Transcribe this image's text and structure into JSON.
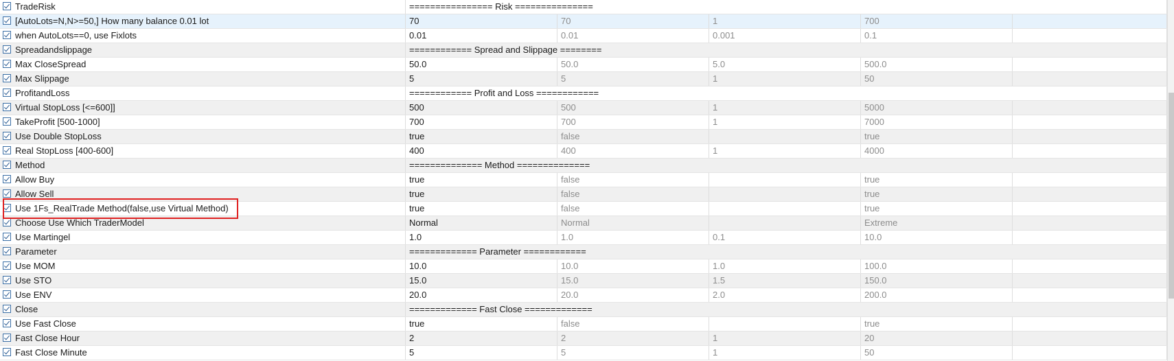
{
  "rows": [
    {
      "name": "TradeRisk",
      "header": "================ Risk ==============="
    },
    {
      "name": "[AutoLots=N,N>=50,] How many balance 0.01 lot",
      "value": "70",
      "start": "70",
      "step": "1",
      "stop": "700"
    },
    {
      "name": "when AutoLots==0,  use Fixlots",
      "value": "0.01",
      "start": "0.01",
      "step": "0.001",
      "stop": "0.1"
    },
    {
      "name": "Spreadandslippage",
      "header": "============ Spread and Slippage ========"
    },
    {
      "name": "Max CloseSpread",
      "value": "50.0",
      "start": "50.0",
      "step": "5.0",
      "stop": "500.0"
    },
    {
      "name": "Max Slippage",
      "value": "5",
      "start": "5",
      "step": "1",
      "stop": "50"
    },
    {
      "name": "ProfitandLoss",
      "header": "============ Profit and Loss ============"
    },
    {
      "name": "Virtual StopLoss [<=600]]",
      "value": "500",
      "start": "500",
      "step": "1",
      "stop": "5000"
    },
    {
      "name": "TakeProfit [500-1000]",
      "value": "700",
      "start": "700",
      "step": "1",
      "stop": "7000"
    },
    {
      "name": "Use Double StopLoss",
      "value": "true",
      "start": "false",
      "step": "",
      "stop": "true"
    },
    {
      "name": "Real StopLoss [400-600]",
      "value": "400",
      "start": "400",
      "step": "1",
      "stop": "4000"
    },
    {
      "name": "Method",
      "header": "============== Method =============="
    },
    {
      "name": "Allow Buy",
      "value": "true",
      "start": "false",
      "step": "",
      "stop": "true"
    },
    {
      "name": "Allow Sell",
      "value": "true",
      "start": "false",
      "step": "",
      "stop": "true"
    },
    {
      "name": "Use 1Fs_RealTrade Method(false,use Virtual Method)",
      "value": "true",
      "start": "false",
      "step": "",
      "stop": "true"
    },
    {
      "name": "Choose Use Which TraderModel",
      "value": "Normal",
      "start": "Normal",
      "step": "",
      "stop": "Extreme"
    },
    {
      "name": "Use Martingel",
      "value": "1.0",
      "start": "1.0",
      "step": "0.1",
      "stop": "10.0"
    },
    {
      "name": "Parameter",
      "header": "============= Parameter ============"
    },
    {
      "name": "Use MOM",
      "value": "10.0",
      "start": "10.0",
      "step": "1.0",
      "stop": "100.0"
    },
    {
      "name": "Use STO",
      "value": "15.0",
      "start": "15.0",
      "step": "1.5",
      "stop": "150.0"
    },
    {
      "name": "Use ENV",
      "value": "20.0",
      "start": "20.0",
      "step": "2.0",
      "stop": "200.0"
    },
    {
      "name": "Close",
      "header": "============= Fast Close ============="
    },
    {
      "name": "Use Fast Close",
      "value": "true",
      "start": "false",
      "step": "",
      "stop": "true"
    },
    {
      "name": "Fast Close Hour",
      "value": "2",
      "start": "2",
      "step": "1",
      "stop": "20"
    },
    {
      "name": "Fast Close Minute",
      "value": "5",
      "start": "5",
      "step": "1",
      "stop": "50"
    }
  ],
  "selected_row": 1,
  "highlighted_row": 14,
  "colors": {
    "highlight_border": "#e02020",
    "selected_row": "#e6f2fc",
    "alt_row": "#f0f0f0",
    "checkbox": "#3a6ea5"
  }
}
